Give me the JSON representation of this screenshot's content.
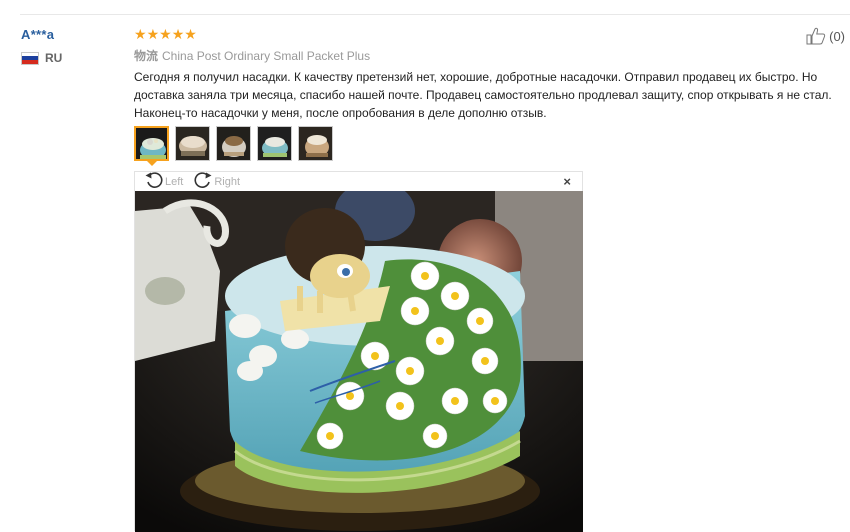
{
  "reviewer": {
    "name": "A***a",
    "country_code": "RU"
  },
  "rating": {
    "stars": 5,
    "max": 5,
    "star_color": "#f6a21e"
  },
  "helpful": {
    "count_label": "(0)"
  },
  "logistics": {
    "label": "物流",
    "carrier": "China Post Ordinary Small Packet Plus"
  },
  "review_text": "Сегодня я получил насадки. К качеству претензий нет, хорошие, добротные насадочки. Отправил продавец их быстро. Но доставка заняла три месяца, спасибо нашей почте. Продавец самостоятельно продлевал защиту, спор открывать я не стал. Наконец-то насадочки у меня, после опробования в деле дополню отзыв.",
  "thumbnails": [
    {
      "name": "review-photo-thumb-1",
      "active": true
    },
    {
      "name": "review-photo-thumb-2",
      "active": false
    },
    {
      "name": "review-photo-thumb-3",
      "active": false
    },
    {
      "name": "review-photo-thumb-4",
      "active": false
    },
    {
      "name": "review-photo-thumb-5",
      "active": false
    }
  ],
  "viewer": {
    "rotate_left_label": "Left",
    "rotate_right_label": "Right",
    "close_label": "×"
  },
  "colors": {
    "username": "#2a5f9e",
    "accent": "#f6a21e"
  }
}
